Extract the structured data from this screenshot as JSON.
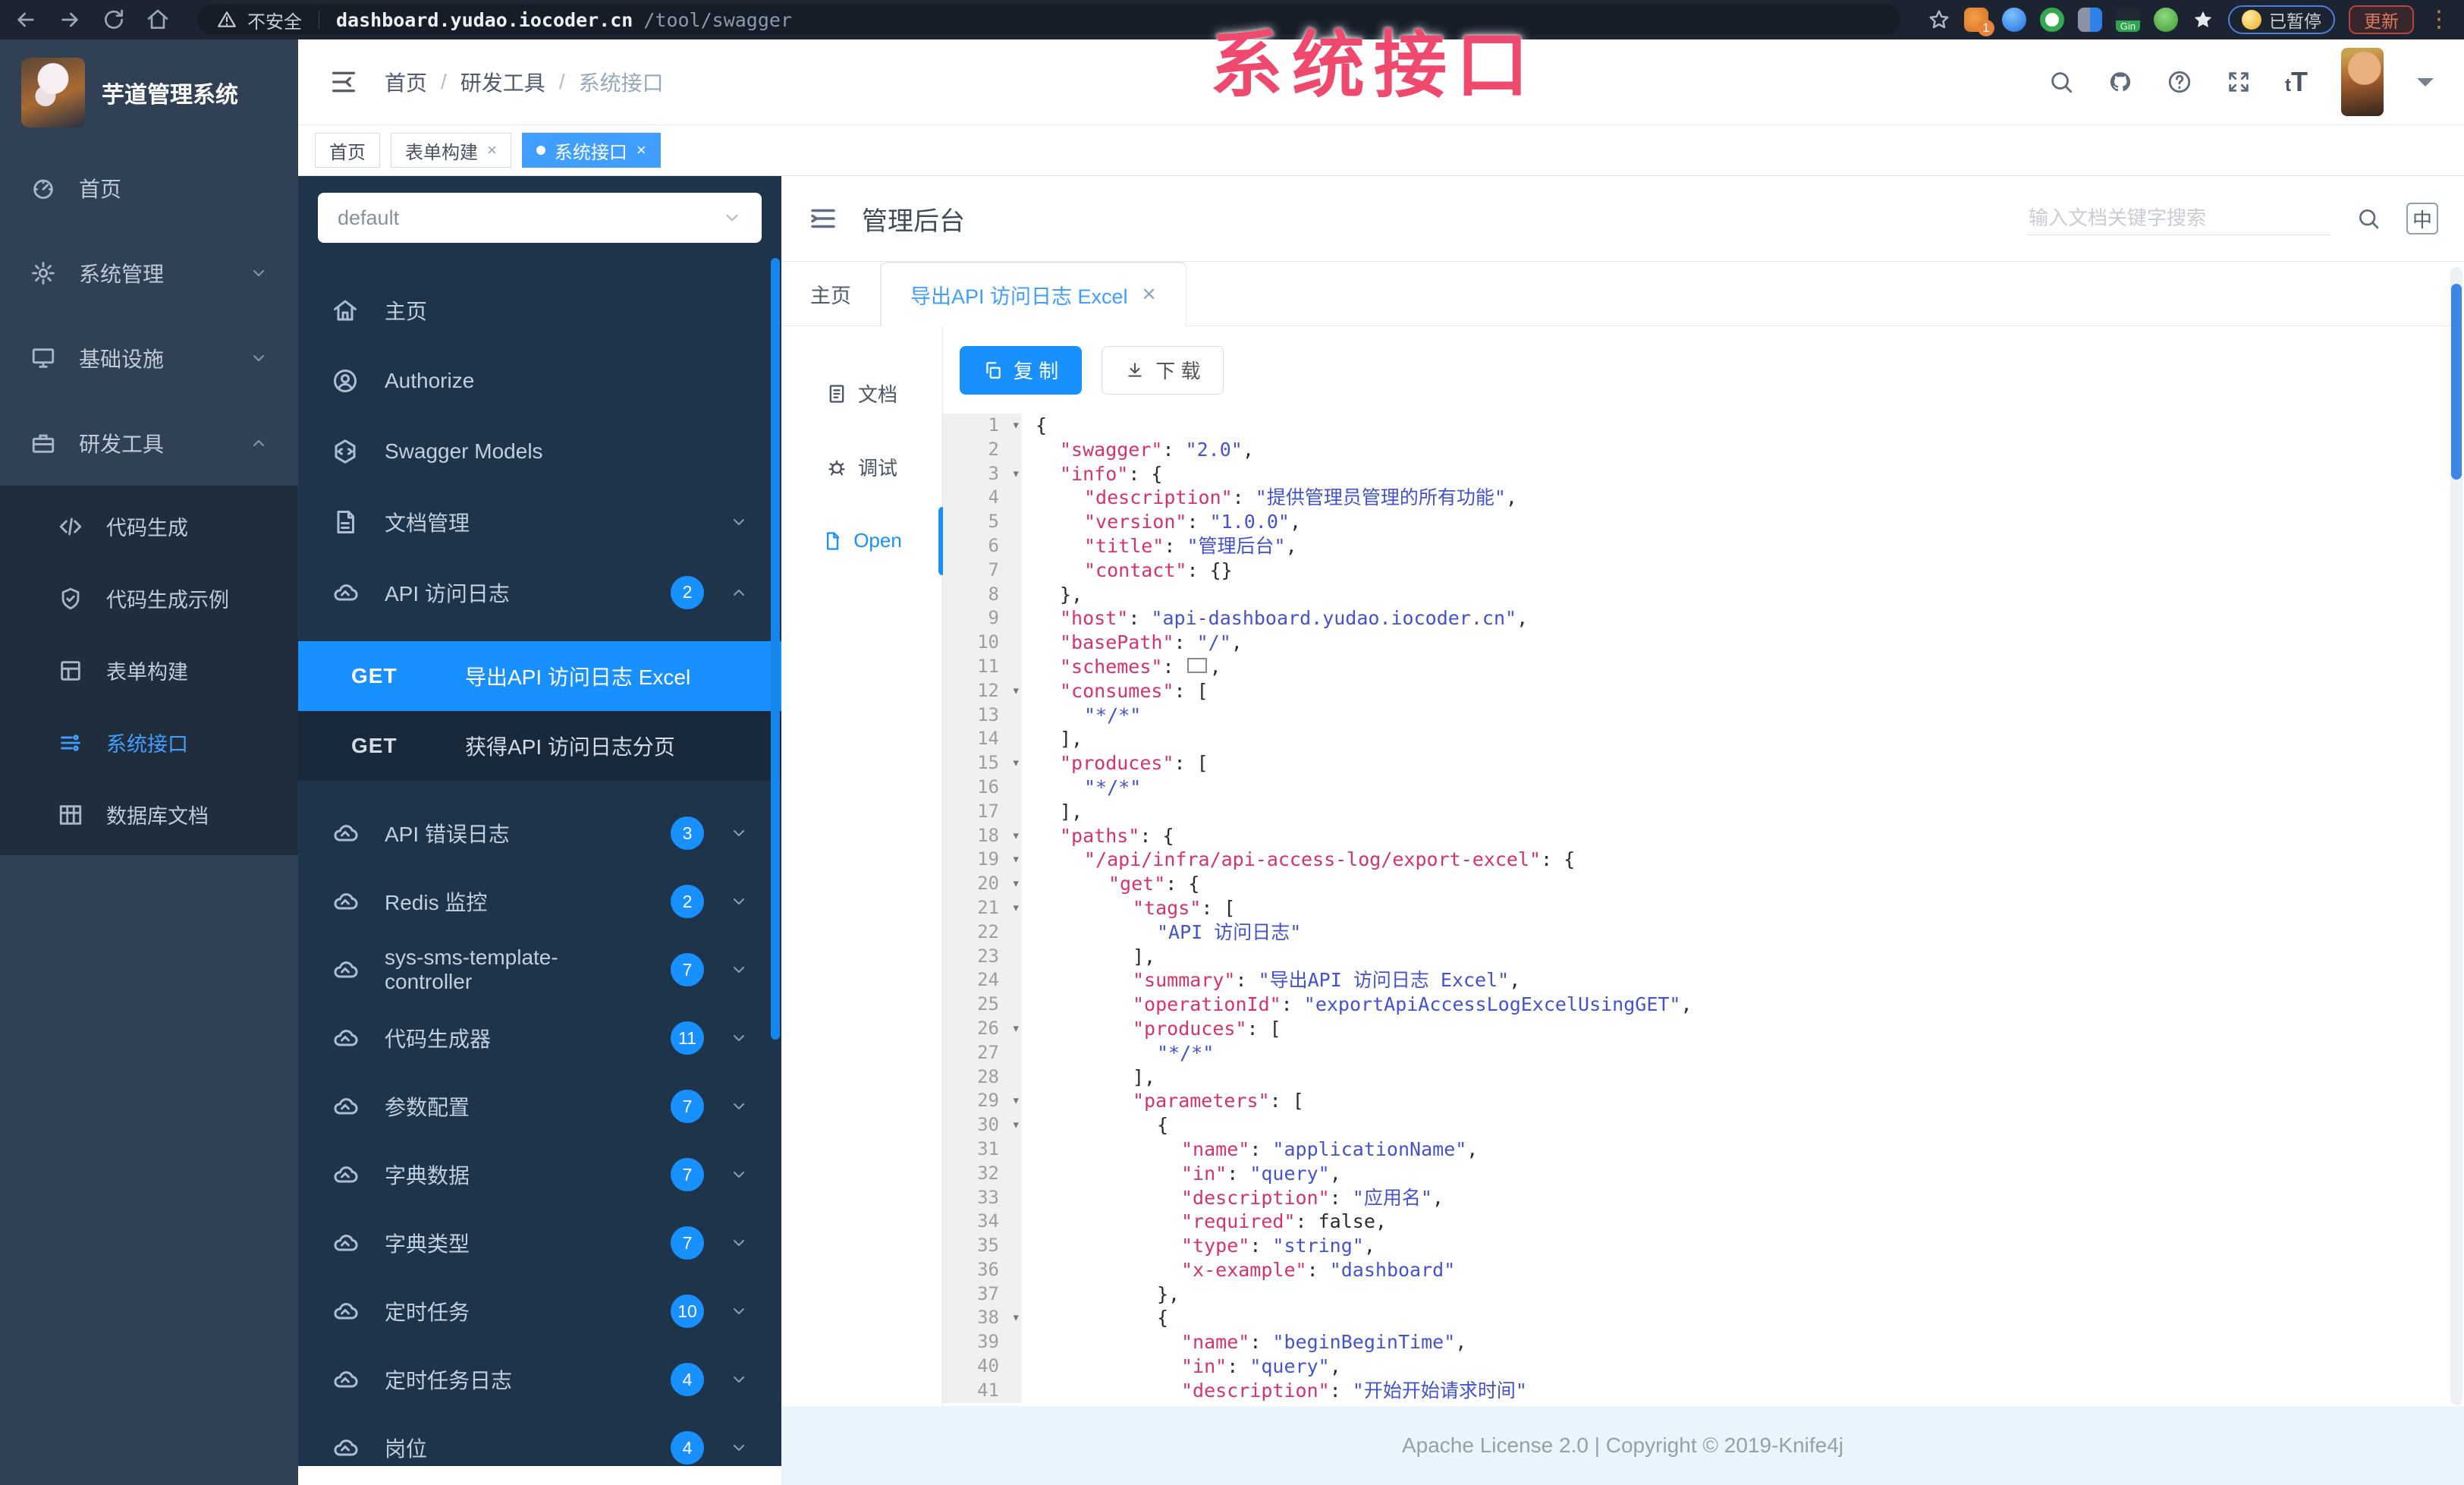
{
  "overlay_label": "系统接口",
  "browser": {
    "security_label": "不安全",
    "url_host": "dashboard.yudao.iocoder.cn",
    "url_path": "/tool/swagger",
    "extension_badge": "1",
    "gin_label": "Gin",
    "paused_label": "已暂停",
    "update_label": "更新"
  },
  "app_sidebar": {
    "logo_title": "芋道管理系统",
    "menu": [
      {
        "label": "首页",
        "icon": "dashboard-icon",
        "expandable": false
      },
      {
        "label": "系统管理",
        "icon": "gear-icon",
        "expandable": true,
        "state": "collapsed"
      },
      {
        "label": "基础设施",
        "icon": "infra-icon",
        "expandable": true,
        "state": "collapsed"
      },
      {
        "label": "研发工具",
        "icon": "tools-icon",
        "expandable": true,
        "state": "expanded"
      }
    ],
    "submenu": [
      {
        "label": "代码生成",
        "icon": "code-icon",
        "active": false
      },
      {
        "label": "代码生成示例",
        "icon": "shield-icon",
        "active": false
      },
      {
        "label": "表单构建",
        "icon": "form-icon",
        "active": false
      },
      {
        "label": "系统接口",
        "icon": "api-icon",
        "active": true
      },
      {
        "label": "数据库文档",
        "icon": "table-icon",
        "active": false
      }
    ]
  },
  "header": {
    "breadcrumb": [
      "首页",
      "研发工具",
      "系统接口"
    ]
  },
  "tag_bar": [
    {
      "label": "首页",
      "active": false,
      "closable": false
    },
    {
      "label": "表单构建",
      "active": false,
      "closable": true
    },
    {
      "label": "系统接口",
      "active": true,
      "closable": true
    }
  ],
  "swagger_sidebar": {
    "group_select": "default",
    "nav": [
      {
        "label": "主页",
        "icon": "home-icon"
      },
      {
        "label": "Authorize",
        "icon": "auth-icon"
      },
      {
        "label": "Swagger Models",
        "icon": "models-icon"
      },
      {
        "label": "文档管理",
        "icon": "docs-icon",
        "chevron": "down"
      },
      {
        "label": "API 访问日志",
        "icon": "cloud-icon",
        "badge": "2",
        "chevron": "up"
      }
    ],
    "operations": [
      {
        "method": "GET",
        "label": "导出API 访问日志 Excel",
        "active": true
      },
      {
        "method": "GET",
        "label": "获得API 访问日志分页",
        "active": false
      }
    ],
    "groups": [
      {
        "label": "API 错误日志",
        "badge": "3"
      },
      {
        "label": "Redis 监控",
        "badge": "2"
      },
      {
        "label": "sys-sms-template-controller",
        "badge": "7"
      },
      {
        "label": "代码生成器",
        "badge": "11"
      },
      {
        "label": "参数配置",
        "badge": "7"
      },
      {
        "label": "字典数据",
        "badge": "7"
      },
      {
        "label": "字典类型",
        "badge": "7"
      },
      {
        "label": "定时任务",
        "badge": "10"
      },
      {
        "label": "定时任务日志",
        "badge": "4"
      },
      {
        "label": "岗位",
        "badge": "4"
      }
    ]
  },
  "main": {
    "title": "管理后台",
    "search_placeholder": "输入文档关键字搜索",
    "lang_toggle": "中",
    "doc_tabs": [
      {
        "label": "主页",
        "active": false,
        "closable": false
      },
      {
        "label": "导出API 访问日志 Excel",
        "active": true,
        "closable": true
      }
    ],
    "side_tabs": [
      {
        "label": "文档",
        "icon": "doc-icon",
        "active": false
      },
      {
        "label": "调试",
        "icon": "bug-icon",
        "active": false
      },
      {
        "label": "Open",
        "icon": "file-icon",
        "active": true
      }
    ],
    "copy_button": "复 制",
    "download_button": "下 载",
    "footer": "Apache License 2.0 | Copyright © 2019-Knife4j"
  },
  "editor": {
    "lines": [
      {
        "n": 1,
        "fold": true,
        "ind": 0,
        "seg": [
          [
            "p",
            "{"
          ]
        ]
      },
      {
        "n": 2,
        "fold": false,
        "ind": 1,
        "seg": [
          [
            "k",
            "\"swagger\""
          ],
          [
            "p",
            ": "
          ],
          [
            "s",
            "\"2.0\""
          ],
          [
            "p",
            ","
          ]
        ]
      },
      {
        "n": 3,
        "fold": true,
        "ind": 1,
        "seg": [
          [
            "k",
            "\"info\""
          ],
          [
            "p",
            ": {"
          ]
        ]
      },
      {
        "n": 4,
        "fold": false,
        "ind": 2,
        "seg": [
          [
            "k",
            "\"description\""
          ],
          [
            "p",
            ": "
          ],
          [
            "s",
            "\"提供管理员管理的所有功能\""
          ],
          [
            "p",
            ","
          ]
        ]
      },
      {
        "n": 5,
        "fold": false,
        "ind": 2,
        "seg": [
          [
            "k",
            "\"version\""
          ],
          [
            "p",
            ": "
          ],
          [
            "s",
            "\"1.0.0\""
          ],
          [
            "p",
            ","
          ]
        ]
      },
      {
        "n": 6,
        "fold": false,
        "ind": 2,
        "seg": [
          [
            "k",
            "\"title\""
          ],
          [
            "p",
            ": "
          ],
          [
            "s",
            "\"管理后台\""
          ],
          [
            "p",
            ","
          ]
        ]
      },
      {
        "n": 7,
        "fold": false,
        "ind": 2,
        "seg": [
          [
            "k",
            "\"contact\""
          ],
          [
            "p",
            ": {}"
          ]
        ]
      },
      {
        "n": 8,
        "fold": false,
        "ind": 1,
        "seg": [
          [
            "p",
            "},"
          ]
        ]
      },
      {
        "n": 9,
        "fold": false,
        "ind": 1,
        "seg": [
          [
            "k",
            "\"host\""
          ],
          [
            "p",
            ": "
          ],
          [
            "s",
            "\"api-dashboard.yudao.iocoder.cn\""
          ],
          [
            "p",
            ","
          ]
        ]
      },
      {
        "n": 10,
        "fold": false,
        "ind": 1,
        "seg": [
          [
            "k",
            "\"basePath\""
          ],
          [
            "p",
            ": "
          ],
          [
            "s",
            "\"/\""
          ],
          [
            "p",
            ","
          ]
        ]
      },
      {
        "n": 11,
        "fold": false,
        "ind": 1,
        "seg": [
          [
            "k",
            "\"schemes\""
          ],
          [
            "p",
            ": "
          ],
          [
            "fb",
            ""
          ],
          [
            "p",
            ","
          ]
        ]
      },
      {
        "n": 12,
        "fold": true,
        "ind": 1,
        "seg": [
          [
            "k",
            "\"consumes\""
          ],
          [
            "p",
            ": ["
          ]
        ]
      },
      {
        "n": 13,
        "fold": false,
        "ind": 2,
        "seg": [
          [
            "s",
            "\"*/*\""
          ]
        ]
      },
      {
        "n": 14,
        "fold": false,
        "ind": 1,
        "seg": [
          [
            "p",
            "],"
          ]
        ]
      },
      {
        "n": 15,
        "fold": true,
        "ind": 1,
        "seg": [
          [
            "k",
            "\"produces\""
          ],
          [
            "p",
            ": ["
          ]
        ]
      },
      {
        "n": 16,
        "fold": false,
        "ind": 2,
        "seg": [
          [
            "s",
            "\"*/*\""
          ]
        ]
      },
      {
        "n": 17,
        "fold": false,
        "ind": 1,
        "seg": [
          [
            "p",
            "],"
          ]
        ]
      },
      {
        "n": 18,
        "fold": true,
        "ind": 1,
        "seg": [
          [
            "k",
            "\"paths\""
          ],
          [
            "p",
            ": {"
          ]
        ]
      },
      {
        "n": 19,
        "fold": true,
        "ind": 2,
        "seg": [
          [
            "k",
            "\"/api/infra/api-access-log/export-excel\""
          ],
          [
            "p",
            ": {"
          ]
        ]
      },
      {
        "n": 20,
        "fold": true,
        "ind": 3,
        "seg": [
          [
            "k",
            "\"get\""
          ],
          [
            "p",
            ": {"
          ]
        ]
      },
      {
        "n": 21,
        "fold": true,
        "ind": 4,
        "seg": [
          [
            "k",
            "\"tags\""
          ],
          [
            "p",
            ": ["
          ]
        ]
      },
      {
        "n": 22,
        "fold": false,
        "ind": 5,
        "seg": [
          [
            "s",
            "\"API 访问日志\""
          ]
        ]
      },
      {
        "n": 23,
        "fold": false,
        "ind": 4,
        "seg": [
          [
            "p",
            "],"
          ]
        ]
      },
      {
        "n": 24,
        "fold": false,
        "ind": 4,
        "seg": [
          [
            "k",
            "\"summary\""
          ],
          [
            "p",
            ": "
          ],
          [
            "s",
            "\"导出API 访问日志 Excel\""
          ],
          [
            "p",
            ","
          ]
        ]
      },
      {
        "n": 25,
        "fold": false,
        "ind": 4,
        "seg": [
          [
            "k",
            "\"operationId\""
          ],
          [
            "p",
            ": "
          ],
          [
            "s",
            "\"exportApiAccessLogExcelUsingGET\""
          ],
          [
            "p",
            ","
          ]
        ]
      },
      {
        "n": 26,
        "fold": true,
        "ind": 4,
        "seg": [
          [
            "k",
            "\"produces\""
          ],
          [
            "p",
            ": ["
          ]
        ]
      },
      {
        "n": 27,
        "fold": false,
        "ind": 5,
        "seg": [
          [
            "s",
            "\"*/*\""
          ]
        ]
      },
      {
        "n": 28,
        "fold": false,
        "ind": 4,
        "seg": [
          [
            "p",
            "],"
          ]
        ]
      },
      {
        "n": 29,
        "fold": true,
        "ind": 4,
        "seg": [
          [
            "k",
            "\"parameters\""
          ],
          [
            "p",
            ": ["
          ]
        ]
      },
      {
        "n": 30,
        "fold": true,
        "ind": 5,
        "seg": [
          [
            "p",
            "{"
          ]
        ]
      },
      {
        "n": 31,
        "fold": false,
        "ind": 6,
        "seg": [
          [
            "k",
            "\"name\""
          ],
          [
            "p",
            ": "
          ],
          [
            "s",
            "\"applicationName\""
          ],
          [
            "p",
            ","
          ]
        ]
      },
      {
        "n": 32,
        "fold": false,
        "ind": 6,
        "seg": [
          [
            "k",
            "\"in\""
          ],
          [
            "p",
            ": "
          ],
          [
            "s",
            "\"query\""
          ],
          [
            "p",
            ","
          ]
        ]
      },
      {
        "n": 33,
        "fold": false,
        "ind": 6,
        "seg": [
          [
            "k",
            "\"description\""
          ],
          [
            "p",
            ": "
          ],
          [
            "s",
            "\"应用名\""
          ],
          [
            "p",
            ","
          ]
        ]
      },
      {
        "n": 34,
        "fold": false,
        "ind": 6,
        "seg": [
          [
            "k",
            "\"required\""
          ],
          [
            "p",
            ": "
          ],
          [
            "v",
            "false"
          ],
          [
            "p",
            ","
          ]
        ]
      },
      {
        "n": 35,
        "fold": false,
        "ind": 6,
        "seg": [
          [
            "k",
            "\"type\""
          ],
          [
            "p",
            ": "
          ],
          [
            "s",
            "\"string\""
          ],
          [
            "p",
            ","
          ]
        ]
      },
      {
        "n": 36,
        "fold": false,
        "ind": 6,
        "seg": [
          [
            "k",
            "\"x-example\""
          ],
          [
            "p",
            ": "
          ],
          [
            "s",
            "\"dashboard\""
          ]
        ]
      },
      {
        "n": 37,
        "fold": false,
        "ind": 5,
        "seg": [
          [
            "p",
            "},"
          ]
        ]
      },
      {
        "n": 38,
        "fold": true,
        "ind": 5,
        "seg": [
          [
            "p",
            "{"
          ]
        ]
      },
      {
        "n": 39,
        "fold": false,
        "ind": 6,
        "seg": [
          [
            "k",
            "\"name\""
          ],
          [
            "p",
            ": "
          ],
          [
            "s",
            "\"beginBeginTime\""
          ],
          [
            "p",
            ","
          ]
        ]
      },
      {
        "n": 40,
        "fold": false,
        "ind": 6,
        "seg": [
          [
            "k",
            "\"in\""
          ],
          [
            "p",
            ": "
          ],
          [
            "s",
            "\"query\""
          ],
          [
            "p",
            ","
          ]
        ]
      },
      {
        "n": 41,
        "fold": false,
        "ind": 6,
        "seg": [
          [
            "k",
            "\"description\""
          ],
          [
            "p",
            ": "
          ],
          [
            "s",
            "\"开始开始请求时间\""
          ]
        ]
      }
    ]
  }
}
